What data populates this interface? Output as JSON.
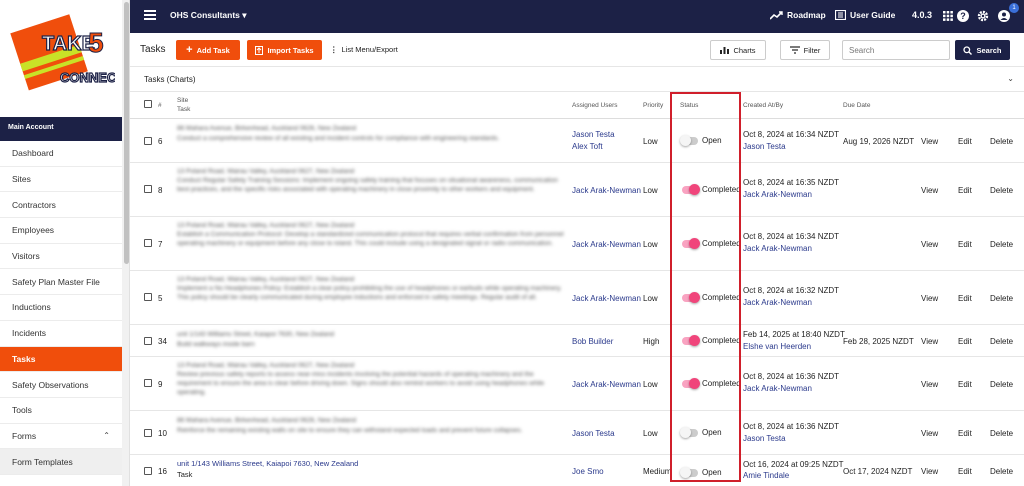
{
  "brand": {
    "logo_text_1": "TAKE",
    "logo_text_2": "5",
    "logo_text_3": "CONNECT",
    "accent": "#f04e0c",
    "navy": "#1c2146"
  },
  "topbar": {
    "org_name": "OHS Consultants",
    "roadmap": "Roadmap",
    "user_guide": "User Guide",
    "version": "4.0.3",
    "notification_count": "1"
  },
  "sidebar": {
    "section_title": "Main Account",
    "items": [
      {
        "label": "Dashboard"
      },
      {
        "label": "Sites"
      },
      {
        "label": "Contractors"
      },
      {
        "label": "Employees"
      },
      {
        "label": "Visitors"
      },
      {
        "label": "Safety Plan Master File"
      },
      {
        "label": "Inductions"
      },
      {
        "label": "Incidents"
      },
      {
        "label": "Tasks"
      },
      {
        "label": "Safety Observations"
      },
      {
        "label": "Tools"
      },
      {
        "label": "Forms"
      },
      {
        "label": "Form Templates"
      }
    ]
  },
  "toolbar": {
    "title": "Tasks",
    "add_task": "Add Task",
    "import_tasks": "Import Tasks",
    "list_menu": "List Menu/Export",
    "charts": "Charts",
    "filter": "Filter",
    "search_placeholder": "Search",
    "search_button": "Search"
  },
  "charts_panel": {
    "label": "Tasks (Charts)"
  },
  "table": {
    "headers": {
      "num": "#",
      "site": "Site",
      "task": "Task",
      "assigned": "Assigned Users",
      "priority": "Priority",
      "status": "Status",
      "created": "Created At/By",
      "due": "Due Date"
    },
    "actions": {
      "view": "View",
      "edit": "Edit",
      "delete": "Delete"
    },
    "rows": [
      {
        "num": "6",
        "site_blur": "86 Mahara Avenue, Birkenhead, Auckland 0626, New Zealand",
        "task_blur": "Conduct a comprehensive review of all existing and incident controls for compliance with engineering standards.",
        "users": [
          "Jason Testa",
          "Alex Toft"
        ],
        "priority": "Low",
        "status": "Open",
        "status_on": false,
        "created_at": "Oct 8, 2024 at 16:34 NZDT",
        "created_by": "Jason Testa",
        "due": "Aug 19, 2026 NZDT"
      },
      {
        "num": "8",
        "site_blur": "13 Poland Road, Wairau Valley, Auckland 0627, New Zealand",
        "task_blur": "Conduct Regular Safety Training Sessions: Implement ongoing safety training that focuses on situational awareness, communication best practices, and the specific risks associated with operating machinery in close proximity to other workers and equipment.",
        "users": [
          "Jack Arak-Newman"
        ],
        "priority": "Low",
        "status": "Completed",
        "status_on": true,
        "created_at": "Oct 8, 2024 at 16:35 NZDT",
        "created_by": "Jack Arak-Newman",
        "due": ""
      },
      {
        "num": "7",
        "site_blur": "13 Poland Road, Wairau Valley, Auckland 0627, New Zealand",
        "task_blur": "Establish a Communication Protocol: Develop a standardized communication protocol that requires verbal confirmation from personnel operating machinery or equipment before any close to island. This could include using a designated signal or radio communication.",
        "users": [
          "Jack Arak-Newman"
        ],
        "priority": "Low",
        "status": "Completed",
        "status_on": true,
        "created_at": "Oct 8, 2024 at 16:34 NZDT",
        "created_by": "Jack Arak-Newman",
        "due": ""
      },
      {
        "num": "5",
        "site_blur": "13 Poland Road, Wairau Valley, Auckland 0627, New Zealand",
        "task_blur": "Implement a No Headphones Policy: Establish a clear policy prohibiting the use of headphones or earbuds while operating machinery. This policy should be clearly communicated during employee inductions and enforced in safety meetings. Regular audit of all.",
        "users": [
          "Jack Arak-Newman"
        ],
        "priority": "Low",
        "status": "Completed",
        "status_on": true,
        "created_at": "Oct 8, 2024 at 16:32 NZDT",
        "created_by": "Jack Arak-Newman",
        "due": ""
      },
      {
        "num": "34",
        "site_blur": "unit 1/143 Williams Street, Kaiapoi 7630, New Zealand",
        "task_blur": "Build walkways inside barn",
        "users": [
          "Bob Builder"
        ],
        "priority": "High",
        "status": "Completed",
        "status_on": true,
        "created_at": "Feb 14, 2025 at 18:40 NZDT",
        "created_by": "Elshe van Heerden",
        "due": "Feb 28, 2025 NZDT"
      },
      {
        "num": "9",
        "site_blur": "13 Poland Road, Wairau Valley, Auckland 0627, New Zealand",
        "task_blur": "Review previous safety reports to assess near-miss incidents involving the potential hazards of operating machinery and the requirement to ensure the area is clear before driving down. Signs should also remind workers to avoid using headphones while operating.",
        "users": [
          "Jack Arak-Newman"
        ],
        "priority": "Low",
        "status": "Completed",
        "status_on": true,
        "created_at": "Oct 8, 2024 at 16:36 NZDT",
        "created_by": "Jack Arak-Newman",
        "due": ""
      },
      {
        "num": "10",
        "site_blur": "86 Mahara Avenue, Birkenhead, Auckland 0626, New Zealand",
        "task_blur": "Reinforce the remaining existing walls on site to ensure they can withstand expected loads and prevent future collapses.",
        "users": [
          "Jason Testa"
        ],
        "priority": "Low",
        "status": "Open",
        "status_on": false,
        "created_at": "Oct 8, 2024 at 16:36 NZDT",
        "created_by": "Jason Testa",
        "due": ""
      },
      {
        "num": "16",
        "site": "unit 1/143 Williams Street, Kaiapoi 7630, New Zealand",
        "task": "Task",
        "users": [
          "Joe Smo"
        ],
        "priority": "Medium",
        "status": "Open",
        "status_on": false,
        "created_at": "Oct 16, 2024 at 09:25 NZDT",
        "created_by": "Amie Tindale",
        "due": "Oct 17, 2024 NZDT"
      }
    ]
  }
}
